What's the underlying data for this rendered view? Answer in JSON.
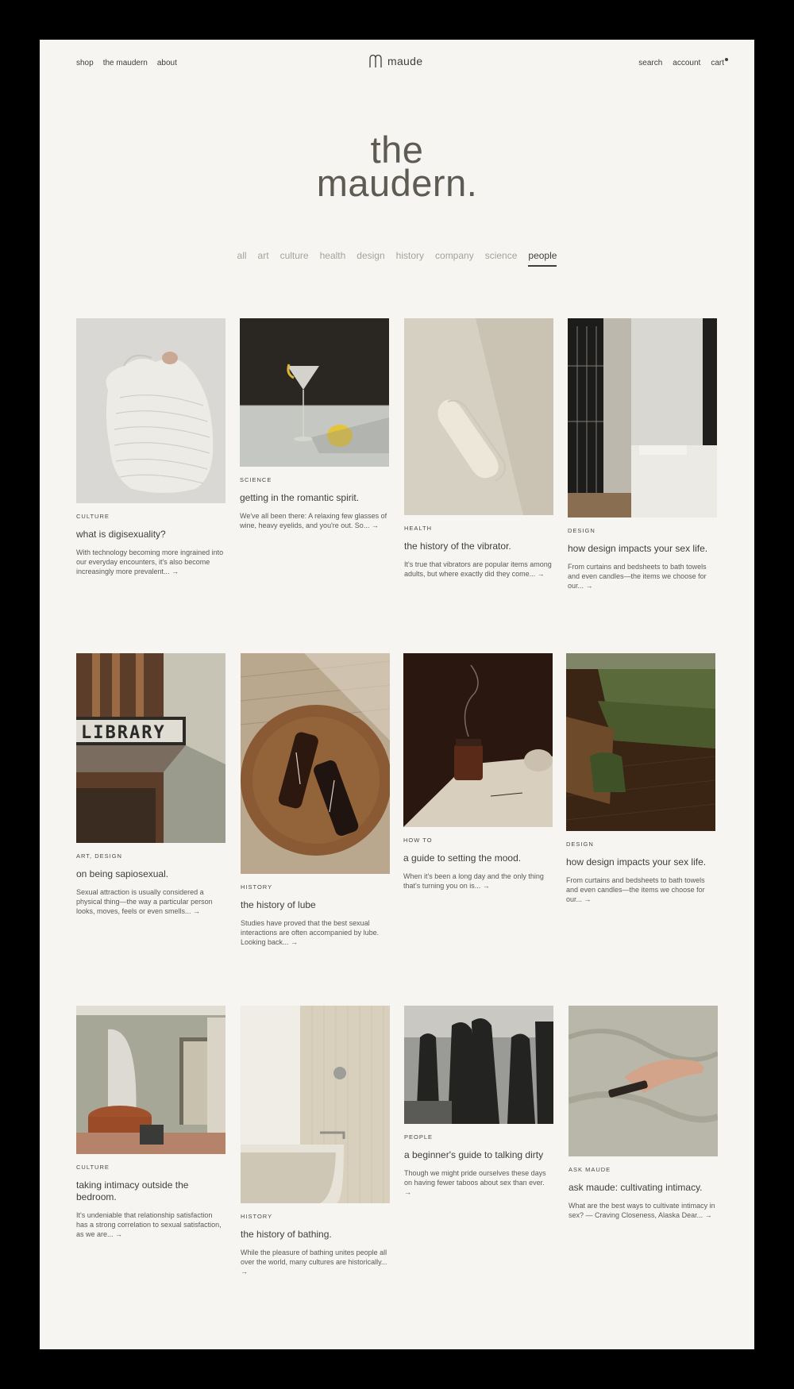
{
  "header": {
    "nav_left": [
      "shop",
      "the maudern",
      "about"
    ],
    "logo_text": "maude",
    "nav_right": [
      "search",
      "account",
      "cart"
    ]
  },
  "hero": {
    "line1": "the",
    "line2": "maudern."
  },
  "filters": {
    "items": [
      "all",
      "art",
      "culture",
      "health",
      "design",
      "history",
      "company",
      "science",
      "people"
    ],
    "active": "people"
  },
  "articles": [
    {
      "category": "culture",
      "title": "what is digisexuality?",
      "excerpt": "With technology becoming more ingrained into our everyday encounters, it's also become increasingly more prevalent... →"
    },
    {
      "category": "science",
      "title": "getting in the romantic spirit.",
      "excerpt": "We've all been there: A relaxing few glasses of wine, heavy eyelids, and you're out. So... →"
    },
    {
      "category": "health",
      "title": "the history of the vibrator.",
      "excerpt": "It's true that vibrators are popular items among adults, but where exactly did they come... →"
    },
    {
      "category": "design",
      "title": "how design impacts your sex life.",
      "excerpt": "From curtains and bedsheets to bath towels and even candles—the items we choose for our... →"
    },
    {
      "category": "art, design",
      "title": "on being sapiosexual.",
      "excerpt": "Sexual attraction is usually considered a physical thing—the way a particular person looks, moves, feels or even smells... →"
    },
    {
      "category": "history",
      "title": "the history of lube",
      "excerpt": "Studies have proved that the best sexual interactions are often accompanied by lube. Looking back... →"
    },
    {
      "category": "how to",
      "title": "a guide to setting the mood.",
      "excerpt": "When it's been a long day and the only thing that's turning you on is... →"
    },
    {
      "category": "design",
      "title": "how design impacts your sex life.",
      "excerpt": "From curtains and bedsheets to bath towels and even candles—the items we choose for our... →"
    },
    {
      "category": "culture",
      "title": "taking intimacy outside the bedroom.",
      "excerpt": "It's undeniable that relationship satisfaction has a strong correlation to sexual satisfaction, as we are... →"
    },
    {
      "category": "history",
      "title": "the history of bathing.",
      "excerpt": "While the pleasure of bathing unites people all over the world, many cultures are historically... →"
    },
    {
      "category": "people",
      "title": "a beginner's guide to talking dirty",
      "excerpt": "Though we might pride ourselves these days on having fewer taboos about sex than ever. →"
    },
    {
      "category": "ask maude",
      "title": "ask maude: cultivating intimacy.",
      "excerpt": "What are the best ways to cultivate intimacy in sex? — Craving Closeness, Alaska Dear... →"
    }
  ],
  "image_text": {
    "library_sign": "LIBRARY"
  }
}
